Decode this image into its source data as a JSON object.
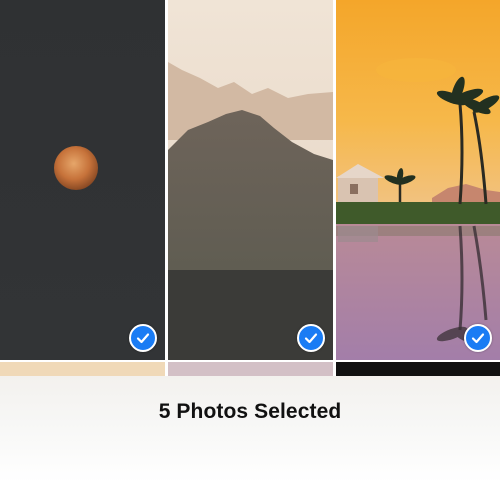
{
  "selection": {
    "status_text": "5 Photos Selected",
    "accent_color": "#1a7cf4"
  },
  "photos": [
    {
      "subject": "moon",
      "selected": true,
      "icon": "checkmark-icon"
    },
    {
      "subject": "mountains",
      "selected": true,
      "icon": "checkmark-icon"
    },
    {
      "subject": "palm-tree-sunset",
      "selected": true,
      "icon": "checkmark-icon"
    }
  ]
}
